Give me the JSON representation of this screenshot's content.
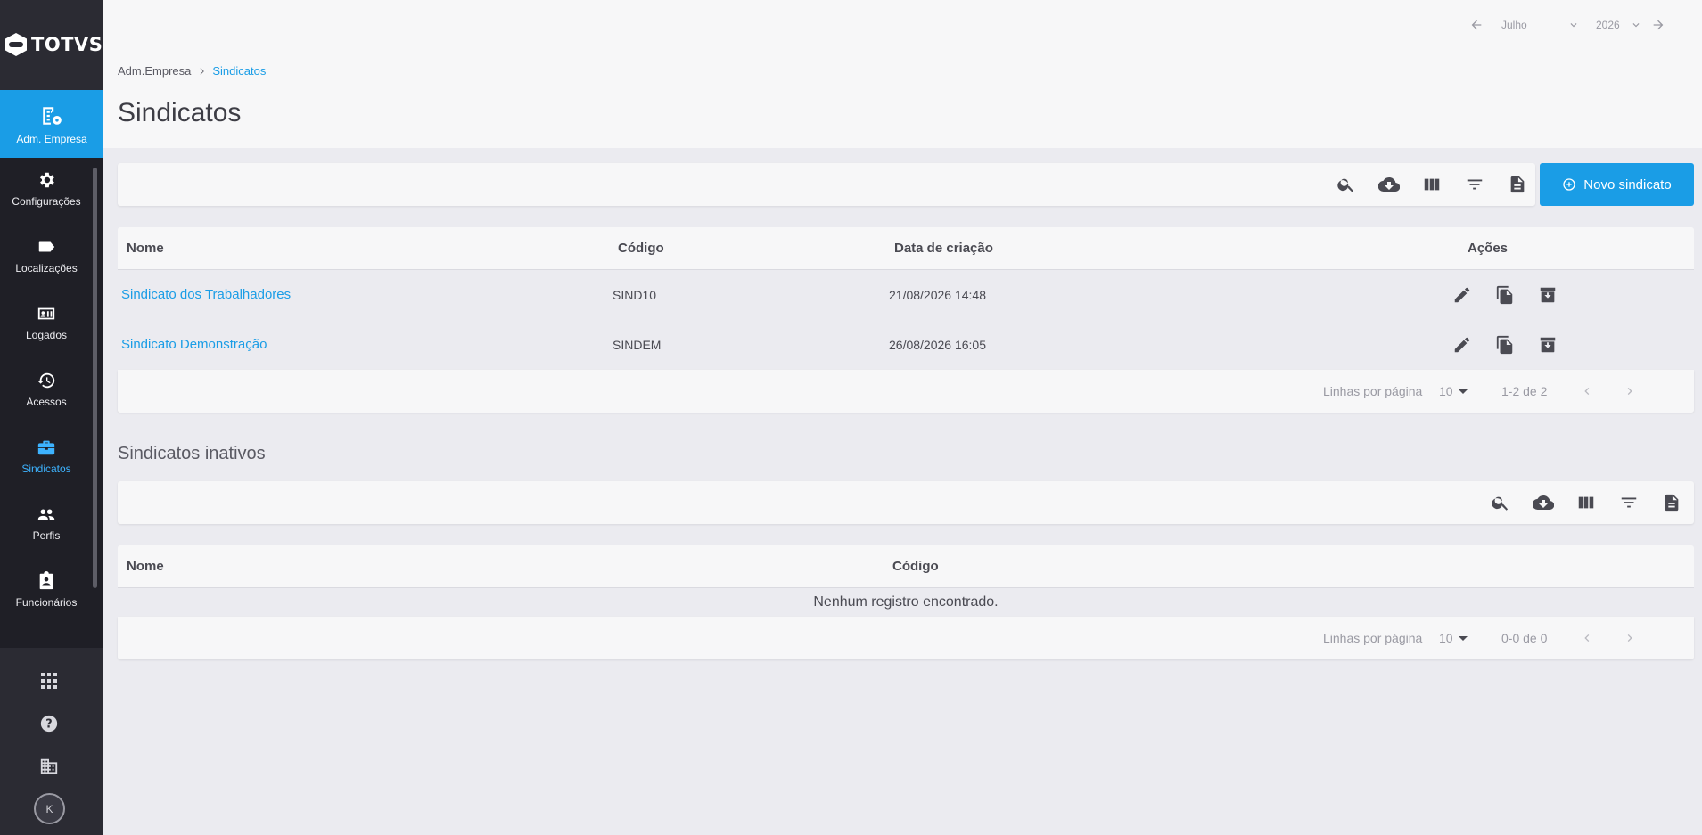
{
  "app": {
    "logo_text": "TOTVS"
  },
  "sidebar": {
    "module": {
      "label": "Adm. Empresa",
      "icon": "company-settings-icon"
    },
    "items": [
      {
        "label": "Configurações",
        "icon": "gear-icon"
      },
      {
        "label": "Localizações",
        "icon": "label-icon"
      },
      {
        "label": "Logados",
        "icon": "badge-icon"
      },
      {
        "label": "Acessos",
        "icon": "history-icon"
      },
      {
        "label": "Sindicatos",
        "icon": "briefcase-icon",
        "active": true
      },
      {
        "label": "Perfis",
        "icon": "people-icon"
      },
      {
        "label": "Funcionários",
        "icon": "clipboard-user-icon"
      }
    ],
    "footer": [
      "apps-grid-icon",
      "help-icon",
      "building-icon"
    ],
    "avatar_initial": "K"
  },
  "header": {
    "period": {
      "month": "Julho",
      "year": "2026"
    },
    "breadcrumb": [
      "Adm.Empresa",
      "Sindicatos"
    ],
    "title": "Sindicatos"
  },
  "active_table": {
    "new_button_label": "Novo sindicato",
    "columns": [
      "Nome",
      "Código",
      "Data de criação",
      "Ações"
    ],
    "rows": [
      {
        "nome": "Sindicato dos Trabalhadores",
        "codigo": "SIND10",
        "data": "21/08/2026 14:48"
      },
      {
        "nome": "Sindicato Demonstração",
        "codigo": "SINDEM",
        "data": "26/08/2026 16:05"
      }
    ],
    "pagination": {
      "rows_per_page_label": "Linhas por página",
      "rows_per_page": "10",
      "range": "1-2 de 2"
    }
  },
  "inactive_table": {
    "title": "Sindicatos inativos",
    "columns": [
      "Nome",
      "Código"
    ],
    "empty_message": "Nenhum registro encontrado.",
    "pagination": {
      "rows_per_page_label": "Linhas por página",
      "rows_per_page": "10",
      "range": "0-0 de 0"
    }
  },
  "colors": {
    "accent": "#1a9de6",
    "sidebar": "#2b2b33",
    "sidebar_nav": "#1f1f26",
    "background": "#ebebf0"
  }
}
